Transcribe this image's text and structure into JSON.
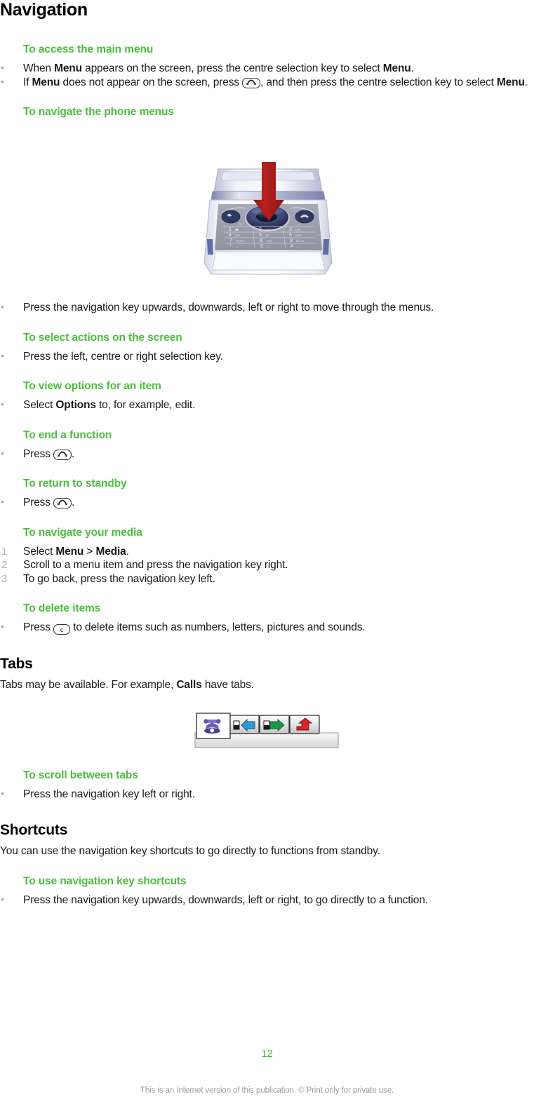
{
  "document": {
    "chapter_title": "Navigation",
    "page_number": "12",
    "colophon": "This is an Internet version of this publication. © Print only for private use."
  },
  "sections": {
    "access_main_menu": {
      "heading": "To access the main menu",
      "bullet1": {
        "part1": "When ",
        "bold1": "Menu",
        "part2": " appears on the screen, press the centre selection key to select ",
        "bold2": "Menu",
        "part3": "."
      },
      "bullet2": {
        "part1": "If ",
        "bold1": "Menu",
        "part2": " does not appear on the screen, press ",
        "key": "end-call-key",
        "part3": ", and then press the centre selection key to select ",
        "bold2": "Menu",
        "part4": "."
      }
    },
    "navigate_phone_menus": {
      "heading": "To navigate the phone menus",
      "bullet1": "Press the navigation key upwards, downwards, left or right to move through the menus.",
      "figure": {
        "name": "phone-keypad-illustration",
        "arrow_color": "#AE1C1C",
        "body_color": "#E8E8EC",
        "keypad_color": "#9A9AA8",
        "navkey_color": "#2C3E68",
        "keys": [
          {
            "digit": "1",
            "letters": ""
          },
          {
            "digit": "2",
            "letters": "ABC"
          },
          {
            "digit": "3",
            "letters": "DEF"
          },
          {
            "digit": "4",
            "letters": "GHI"
          },
          {
            "digit": "5",
            "letters": "JKL"
          },
          {
            "digit": "6",
            "letters": "MNO"
          },
          {
            "digit": "7",
            "letters": "PQRS"
          },
          {
            "digit": "8",
            "letters": "TUV"
          },
          {
            "digit": "9",
            "letters": "WXYZ"
          },
          {
            "digit": "*",
            "letters": "+"
          },
          {
            "digit": "0",
            "letters": ""
          },
          {
            "digit": "#",
            "letters": ""
          }
        ]
      }
    },
    "select_actions": {
      "heading": "To select actions on the screen",
      "bullet1": "Press the left, centre or right selection key."
    },
    "view_options": {
      "heading": "To view options for an item",
      "bullet1": {
        "part1": "Select ",
        "bold1": "Options",
        "part2": " to, for example, edit."
      }
    },
    "end_function": {
      "heading": "To end a function",
      "bullet1": {
        "part1": "Press ",
        "key": "end-call-key",
        "part2": "."
      }
    },
    "return_standby": {
      "heading": "To return to standby",
      "bullet1": {
        "part1": "Press ",
        "key": "end-call-key",
        "part2": "."
      }
    },
    "navigate_media": {
      "heading": "To navigate your media",
      "steps": [
        {
          "part1": "Select ",
          "bold1": "Menu",
          "part2": " > ",
          "bold2": "Media",
          "part3": "."
        },
        {
          "part1": "Scroll to a menu item and press the navigation key right."
        },
        {
          "part1": "To go back, press the navigation key left."
        }
      ]
    },
    "delete_items": {
      "heading": "To delete items",
      "bullet1": {
        "part1": "Press ",
        "key": "clear-key",
        "key_label": "c",
        "part2": " to delete items such as numbers, letters, pictures and sounds."
      }
    },
    "tabs": {
      "heading": "Tabs",
      "intro": {
        "part1": "Tabs may be available. For example, ",
        "bold1": "Calls",
        "part2": " have tabs."
      },
      "figure": {
        "name": "calls-tabs-illustration",
        "tabs": [
          {
            "name": "all-calls-tab",
            "icon": "telephone-icon",
            "color": "#6A5FA8",
            "active": true
          },
          {
            "name": "received-calls-tab",
            "icon": "arrow-left-icon",
            "color": "#2E9BD6",
            "active": false
          },
          {
            "name": "dialled-calls-tab",
            "icon": "arrow-right-icon",
            "color": "#179B4B",
            "active": false
          },
          {
            "name": "missed-calls-tab",
            "icon": "arrow-up-icon",
            "color": "#D8232A",
            "active": false
          }
        ]
      },
      "scroll_heading": "To scroll between tabs",
      "scroll_bullet": "Press the navigation key left or right."
    },
    "shortcuts": {
      "heading": "Shortcuts",
      "intro": "You can use the navigation key shortcuts to go directly to functions from standby.",
      "use_heading": "To use navigation key shortcuts",
      "bullet1": "Press the navigation key upwards, downwards, left or right, to go directly to a function."
    }
  },
  "colors": {
    "heading_green": "#4CBD3F",
    "page_number_green": "#3DBE2E",
    "body_text": "#1a1a1a",
    "bullet_gray": "#a8a8a8",
    "step_number_gray": "#b5b5b5",
    "colophon_gray": "#9a9a9a"
  }
}
